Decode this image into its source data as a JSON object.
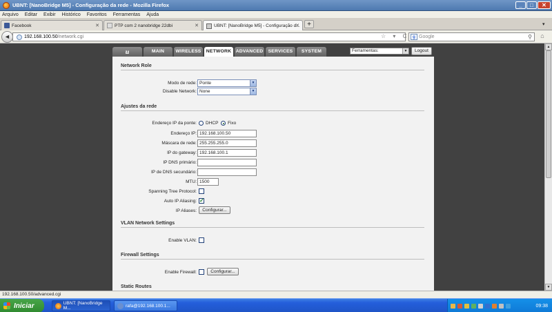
{
  "window": {
    "title": "UBNT: [NanoBridge M5] - Configuração da rede - Mozilla Firefox",
    "min": "_",
    "max": "□",
    "close": "✕"
  },
  "menu": [
    "Arquivo",
    "Editar",
    "Exibir",
    "Histórico",
    "Favoritos",
    "Ferramentas",
    "Ajuda"
  ],
  "tabs": [
    {
      "label": "Facebook"
    },
    {
      "label": "PTP com 2 nanobridge 22dbi"
    },
    {
      "label": "UBNT: [NanoBridge M5] - Configuração d..."
    }
  ],
  "new_tab": "+",
  "nav": {
    "back": "◄",
    "url_host": "192.168.100.50",
    "url_path": "/network.cgi",
    "url_icons": "☆ ▾ C",
    "search_placeholder": "Google",
    "search_engine": "g",
    "search_icon": "⚲",
    "home": "⌂"
  },
  "device": {
    "logo": "u",
    "tabs": [
      "MAIN",
      "WIRELESS",
      "NETWORK",
      "ADVANCED",
      "SERVICES",
      "SYSTEM"
    ],
    "active_tab": "NETWORK",
    "tools_select": "Ferramentas:",
    "logout": "Logout"
  },
  "form": {
    "network_role": {
      "heading": "Network Role",
      "mode_label": "Modo de rede:",
      "mode_value": "Ponte",
      "disable_label": "Disable Network:",
      "disable_value": "None"
    },
    "bridge": {
      "heading": "Ajustes da rede",
      "ip_mode_label": "Endereço IP da ponte:",
      "dhcp": "DHCP",
      "fixed": "Fixo",
      "ip_label": "Endereço IP:",
      "ip_value": "192.168.100.50",
      "mask_label": "Máscara de rede:",
      "mask_value": "255.255.255.0",
      "gw_label": "IP do gateway:",
      "gw_value": "192.168.100.1",
      "dns1_label": "IP DNS primário:",
      "dns1_value": "",
      "dns2_label": "IP de DNS secundário:",
      "dns2_value": "",
      "mtu_label": "MTU:",
      "mtu_value": "1500",
      "stp_label": "Spanning Tree Protocol:",
      "alias_label": "Auto IP Aliasing:",
      "aliases_label": "IP Aliases:",
      "aliases_btn": "Configurar..."
    },
    "vlan": {
      "heading": "VLAN Network Settings",
      "enable_label": "Enable VLAN:"
    },
    "firewall": {
      "heading": "Firewall Settings",
      "enable_label": "Enable Firewall:",
      "btn": "Configurar..."
    },
    "routes": {
      "heading": "Static Routes"
    }
  },
  "status_bar": "192.168.100.50/advanced.cgi",
  "taskbar": {
    "start": "Iniciar",
    "items": [
      "UBNT: [NanoBridge M...",
      "rafa@192.168.100.1..."
    ],
    "time": "09:38"
  }
}
